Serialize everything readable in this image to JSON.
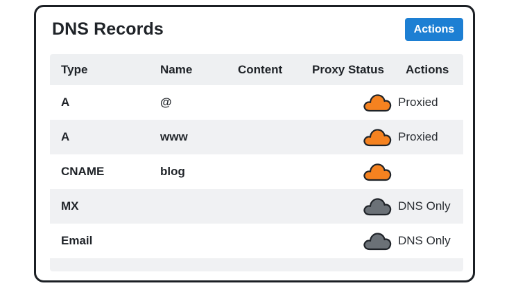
{
  "card": {
    "title": "DNS Records",
    "actions_button": "Actions"
  },
  "table": {
    "headers": {
      "type": "Type",
      "name": "Name",
      "content": "Content",
      "proxy_status": "Proxy Status",
      "actions": "Actions"
    },
    "rows": [
      {
        "type": "A",
        "name": "@",
        "content": "",
        "status": "Proxied",
        "cloud": "orange-cloud-icon"
      },
      {
        "type": "A",
        "name": "www",
        "content": "",
        "status": "Proxied",
        "cloud": "orange-cloud-icon"
      },
      {
        "type": "CNAME",
        "name": "blog",
        "content": "",
        "status": "",
        "cloud": "orange-cloud-icon"
      },
      {
        "type": "MX",
        "name": "",
        "content": "",
        "status": "DNS Only",
        "cloud": "gray-cloud-icon"
      },
      {
        "type": "Email",
        "name": "",
        "content": "",
        "status": "DNS Only",
        "cloud": "gray-cloud-icon"
      }
    ]
  },
  "colors": {
    "accent": "#1d7fd3",
    "proxied_cloud": "#f58220",
    "dns_only_cloud": "#6b7177",
    "border": "#1b1f24",
    "header_bg": "#eef0f2",
    "shaded_row_bg": "#f0f1f3"
  }
}
